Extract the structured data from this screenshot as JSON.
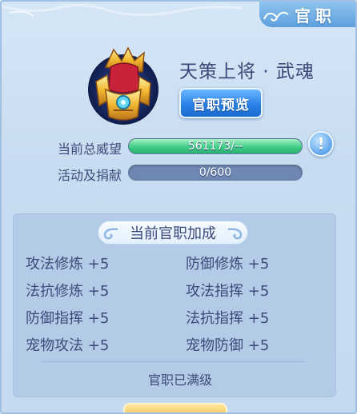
{
  "window": {
    "title": "官职"
  },
  "rank": {
    "name": "天策上将 · 武魂"
  },
  "preview_button": {
    "label": "官职预览"
  },
  "stats": {
    "prestige": {
      "label": "当前总威望",
      "value_text": "561173/--",
      "fill_fraction": 1.0
    },
    "activity": {
      "label": "活动及捐献",
      "value_text": "0/600",
      "fill_fraction": 0.0
    }
  },
  "info_button": {
    "glyph": "!"
  },
  "bonus": {
    "title": "当前官职加成",
    "items": [
      {
        "name": "攻法修炼",
        "value": "+5"
      },
      {
        "name": "防御修炼",
        "value": "+5"
      },
      {
        "name": "法抗修炼",
        "value": "+5"
      },
      {
        "name": "攻法指挥",
        "value": "+5"
      },
      {
        "name": "防御指挥",
        "value": "+5"
      },
      {
        "name": "法抗指挥",
        "value": "+5"
      },
      {
        "name": "宠物攻法",
        "value": "+5"
      },
      {
        "name": "宠物防御",
        "value": "+5"
      }
    ],
    "status": "官职已满级"
  },
  "colors": {
    "panel_bg": "#c8dcf1",
    "title_tab": "#5e9fdc",
    "progress_green": "#3fce88",
    "button_blue": "#2a82e8",
    "text_dark": "#3c4a7a"
  }
}
